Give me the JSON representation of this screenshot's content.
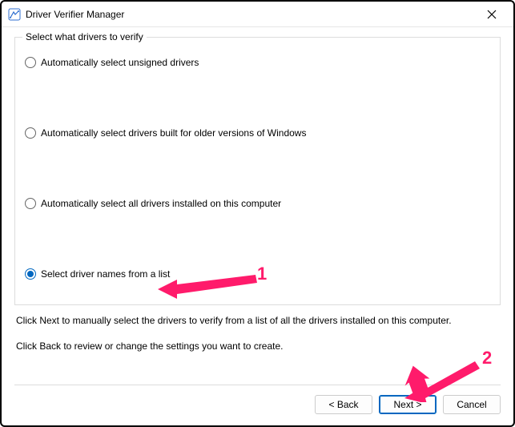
{
  "window": {
    "title": "Driver Verifier Manager",
    "close_icon": "×"
  },
  "group": {
    "legend": "Select what drivers to verify",
    "options": [
      {
        "label": "Automatically select unsigned drivers"
      },
      {
        "label": "Automatically select drivers built for older versions of Windows"
      },
      {
        "label": "Automatically select all drivers installed on this computer"
      },
      {
        "label": "Select driver names from a list"
      }
    ],
    "selected_index": 3
  },
  "description": {
    "line1": "Click Next to manually select the drivers to verify from a list of all the drivers installed on this computer.",
    "line2": "Click Back to review or change the settings you want to create."
  },
  "buttons": {
    "back": "< Back",
    "next": "Next >",
    "cancel": "Cancel"
  },
  "annotations": {
    "n1": "1",
    "n2": "2"
  }
}
